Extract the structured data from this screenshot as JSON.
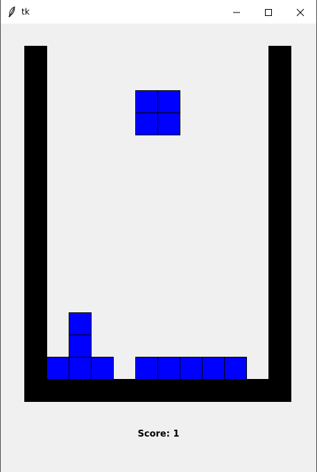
{
  "window": {
    "title": "tk",
    "icon": "feather-icon",
    "controls": [
      "minimize-icon",
      "maximize-icon",
      "close-icon"
    ]
  },
  "game": {
    "wall_color": "#000000",
    "block_color": "#0000ff",
    "block_border_color": "#000000",
    "cols": 10,
    "rows": 15,
    "falling_piece": {
      "shape": "O",
      "cells": [
        [
          5,
          2
        ],
        [
          6,
          2
        ],
        [
          5,
          3
        ],
        [
          6,
          3
        ]
      ]
    },
    "settled_blocks": [
      [
        2,
        12
      ],
      [
        2,
        13
      ],
      [
        1,
        14
      ],
      [
        2,
        14
      ],
      [
        3,
        14
      ],
      [
        5,
        14
      ],
      [
        6,
        14
      ],
      [
        7,
        14
      ],
      [
        8,
        14
      ],
      [
        9,
        14
      ]
    ],
    "score_text": "Score: 1"
  }
}
